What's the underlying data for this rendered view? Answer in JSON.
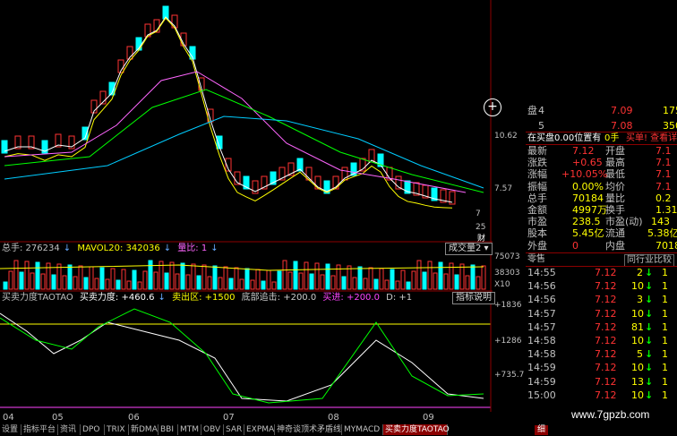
{
  "price_axis": {
    "upper": "10.62",
    "lower": "7.57"
  },
  "vol_axis": {
    "top": "75073",
    "mid": "38303",
    "unit": "X10"
  },
  "ind_axis": {
    "a": "+1836",
    "b": "+1286",
    "c": "+735.7"
  },
  "vol_bar": {
    "total": "总手: 276234",
    "mavol": "MAVOL20: 342036",
    "ratio": "量比: 1",
    "button": "成交量2"
  },
  "ind_bar": {
    "name": "买卖力度TAOTAO",
    "strength": "买卖力度: +460.6",
    "sell_zone": "卖出区: +1500",
    "bottom": "底部追击: +200.0",
    "buy": "买进: +200.0",
    "d": "D: +1",
    "button": "指标说明"
  },
  "dates": [
    "04",
    "05",
    "06",
    "07",
    "08",
    "09"
  ],
  "colors": {
    "up": "#ff3333",
    "down": "#00ffff",
    "yellow": "#ffff00",
    "green": "#00ff00",
    "orange": "#ff9900"
  },
  "right_panel": {
    "ask_rows": [
      {
        "label": "盘",
        "idx": "4",
        "price": "7.09",
        "vol": "175"
      },
      {
        "label": "",
        "idx": "5",
        "price": "7.08",
        "vol": "350"
      }
    ],
    "pending": {
      "text": "在买盘0.00位置有",
      "lots": "0手",
      "link": "买单! 查看详情"
    },
    "stats": [
      {
        "l1": "最新",
        "v1": "7.12",
        "l2": "开盘",
        "v2": "7.1"
      },
      {
        "l1": "涨跌",
        "v1": "+0.65",
        "l2": "最高",
        "v2": "7.1"
      },
      {
        "l1": "涨幅",
        "v1": "+10.05%",
        "l2": "最低",
        "v2": "7.1"
      },
      {
        "l1": "振幅",
        "v1": "0.00%",
        "l2": "均价",
        "v2": "7.1"
      },
      {
        "l1": "总手",
        "v1": "70184",
        "l2": "量比",
        "v2": "0.2"
      },
      {
        "l1": "金额",
        "v1": "4997万",
        "l2": "换手",
        "v2": "1.31"
      },
      {
        "l1": "市盈",
        "v1": "238.5",
        "l2": "市盈(动)",
        "v2": "143"
      },
      {
        "l1": "股本",
        "v1": "5.45亿",
        "l2": "流通",
        "v2": "5.38亿"
      },
      {
        "l1": "外盘",
        "v1": "0",
        "l2": "内盘",
        "v2": "7018"
      }
    ],
    "ticks_header": {
      "left": "零售",
      "right": "同行业比较"
    },
    "ticks": [
      {
        "time": "14:55",
        "price": "7.12",
        "vol": "2"
      },
      {
        "time": "14:56",
        "price": "7.12",
        "vol": "10"
      },
      {
        "time": "14:56",
        "price": "7.12",
        "vol": "3"
      },
      {
        "time": "14:57",
        "price": "7.12",
        "vol": "10"
      },
      {
        "time": "14:57",
        "price": "7.12",
        "vol": "81"
      },
      {
        "time": "14:58",
        "price": "7.12",
        "vol": "10"
      },
      {
        "time": "14:58",
        "price": "7.12",
        "vol": "5"
      },
      {
        "time": "14:59",
        "price": "7.12",
        "vol": "10"
      },
      {
        "time": "14:59",
        "price": "7.12",
        "vol": "13"
      },
      {
        "time": "15:00",
        "price": "7.12",
        "vol": "10"
      }
    ]
  },
  "misc_labels": {
    "side_25": "25",
    "side_cai": "财",
    "side_seven": "7"
  },
  "tabs": [
    "设置",
    "指标平台",
    "资讯",
    "DPO",
    "TRIX",
    "新DMA",
    "BBI",
    "MTM",
    "OBV",
    "SAR",
    "EXPMA",
    "神奇谈顶术矛盾线",
    "MYMACD",
    "买卖力度TAOTAO"
  ],
  "active_tab": "买卖力度TAOTAO",
  "detail_tab": "细",
  "watermark": "www.7gpzb.com"
}
